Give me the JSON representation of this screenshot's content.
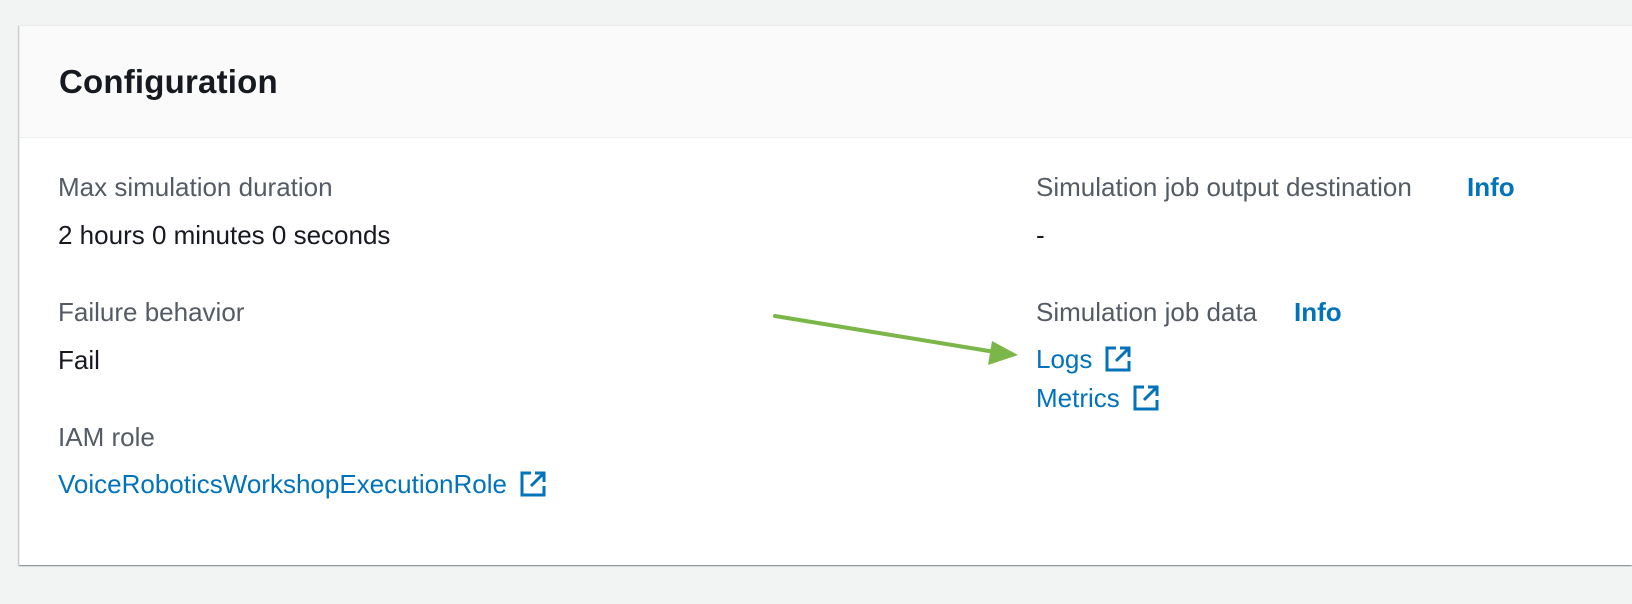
{
  "panel": {
    "title": "Configuration"
  },
  "left_column": {
    "max_duration_label": "Max simulation duration",
    "max_duration_value": "2 hours 0 minutes 0 seconds",
    "failure_behavior_label": "Failure behavior",
    "failure_behavior_value": "Fail",
    "iam_role_label": "IAM role",
    "iam_role_link": "VoiceRoboticsWorkshopExecutionRole"
  },
  "right_column": {
    "output_destination_label": "Simulation job output destination",
    "output_destination_info": "Info",
    "output_destination_value": "-",
    "job_data_label": "Simulation job data",
    "job_data_info": "Info",
    "logs_link": "Logs",
    "metrics_link": "Metrics"
  },
  "colors": {
    "link": "#0073bb",
    "annotation_arrow": "#7ab648",
    "label": "#545b64",
    "value": "#16191f"
  },
  "icons": {
    "external_link": "external-link-icon",
    "annotation": "green-arrow"
  }
}
